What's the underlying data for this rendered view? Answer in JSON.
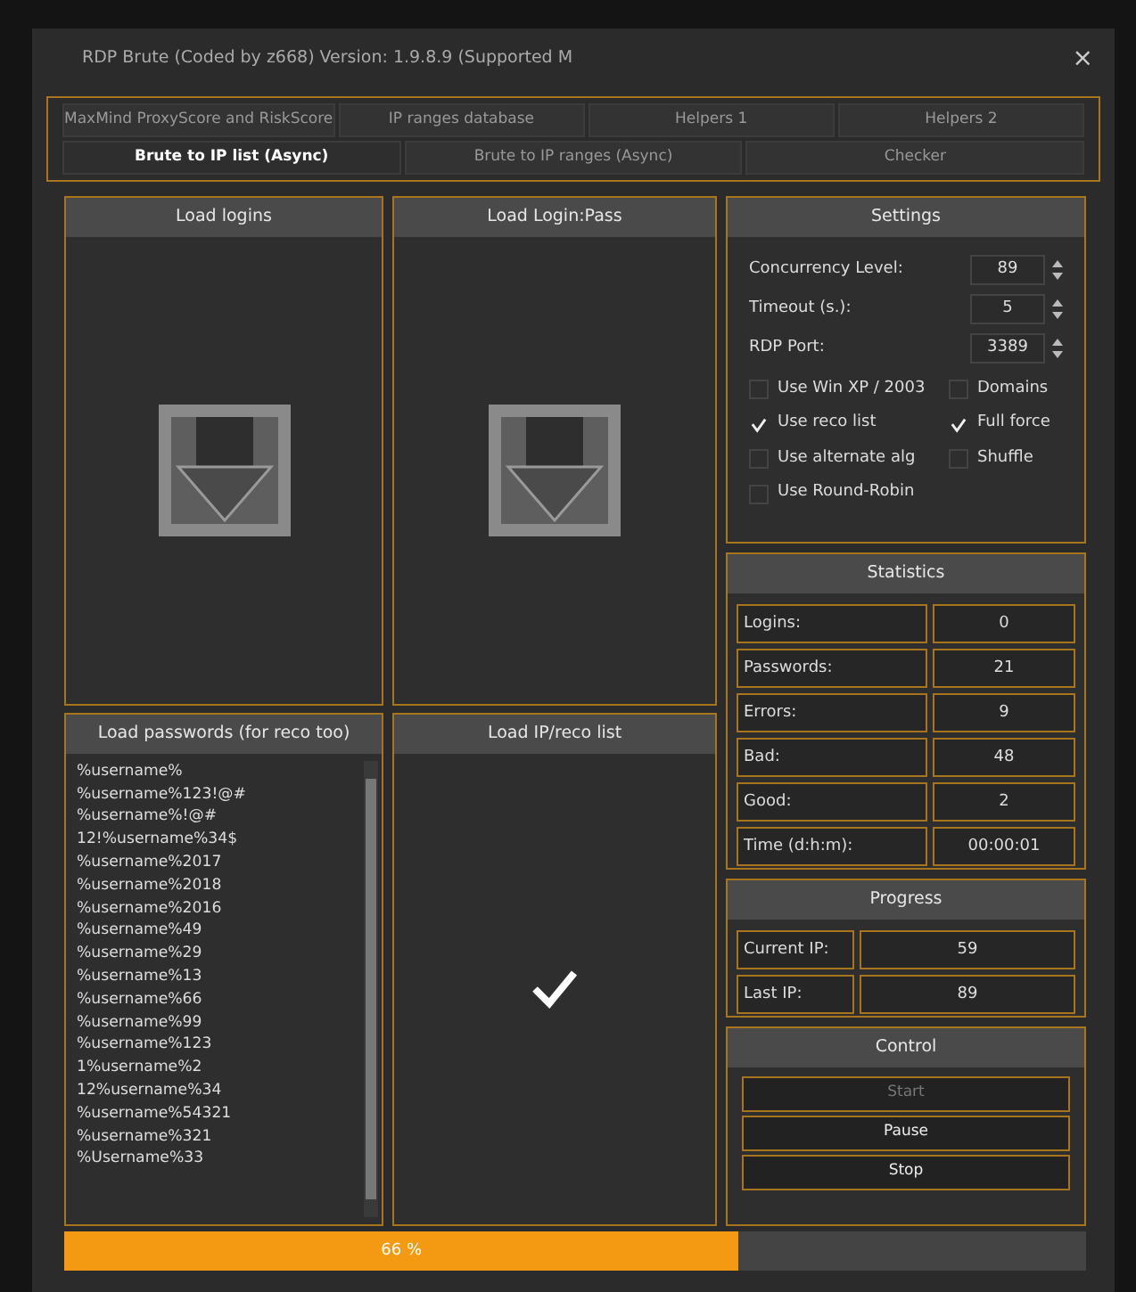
{
  "window": {
    "title": "RDP Brute (Coded by z668) Version: 1.9.8.9 (Supported M",
    "close": "×"
  },
  "tab_rows": [
    [
      {
        "label": "MaxMind ProxyScore and RiskScore",
        "selected": false
      },
      {
        "label": "IP ranges database",
        "selected": false
      },
      {
        "label": "Helpers 1",
        "selected": false
      },
      {
        "label": "Helpers 2",
        "selected": false
      }
    ],
    [
      {
        "label": "Brute to IP list (Async)",
        "selected": true
      },
      {
        "label": "Brute to IP ranges (Async)",
        "selected": false
      },
      {
        "label": "Checker",
        "selected": false
      }
    ]
  ],
  "load_panels": [
    {
      "title": "Load logins",
      "kind": "drop"
    },
    {
      "title": "Load Login:Pass",
      "kind": "drop"
    },
    {
      "title": "Load passwords (for reco too)",
      "kind": "list",
      "items": [
        "%username%",
        "%username%123!@#",
        "%username%!@#",
        "12!%username%34$",
        "%username%2017",
        "%username%2018",
        "%username%2016",
        "%username%49",
        "%username%29",
        "%username%13",
        "%username%66",
        "%username%99",
        "%username%123",
        "1%username%2",
        "12%username%34",
        "%username%54321",
        "%username%321",
        "%Username%33"
      ]
    },
    {
      "title": "Load IP/reco list",
      "kind": "loaded"
    }
  ],
  "settings": {
    "title": "Settings",
    "spinners": [
      {
        "label": "Concurrency Level:",
        "value": "89"
      },
      {
        "label": "Timeout (s.):",
        "value": "5"
      },
      {
        "label": "RDP Port:",
        "value": "3389"
      }
    ],
    "checkboxes": [
      {
        "label": "Use Win XP / 2003",
        "checked": false
      },
      {
        "label": "Domains",
        "checked": false
      },
      {
        "label": "Use reco list",
        "checked": true
      },
      {
        "label": "Full force",
        "checked": true
      },
      {
        "label": "Use alternate alg",
        "checked": false
      },
      {
        "label": "Shuffle",
        "checked": false
      },
      {
        "label": "Use Round-Robin",
        "checked": false
      }
    ]
  },
  "statistics": {
    "title": "Statistics",
    "rows": [
      {
        "label": "Logins:",
        "value": "0"
      },
      {
        "label": "Passwords:",
        "value": "21"
      },
      {
        "label": "Errors:",
        "value": "9"
      },
      {
        "label": "Bad:",
        "value": "48"
      },
      {
        "label": "Good:",
        "value": "2"
      },
      {
        "label": "Time (d:h:m):",
        "value": "00:00:01"
      }
    ]
  },
  "progress": {
    "title": "Progress",
    "rows": [
      {
        "label": "Current IP:",
        "value": "59"
      },
      {
        "label": "Last IP:",
        "value": "89"
      }
    ]
  },
  "control": {
    "title": "Control",
    "buttons": [
      {
        "label": "Start",
        "disabled": true
      },
      {
        "label": "Pause",
        "disabled": false
      },
      {
        "label": "Stop",
        "disabled": false
      }
    ]
  },
  "progress_bar": {
    "level": 0.66,
    "reading": "66 %"
  }
}
